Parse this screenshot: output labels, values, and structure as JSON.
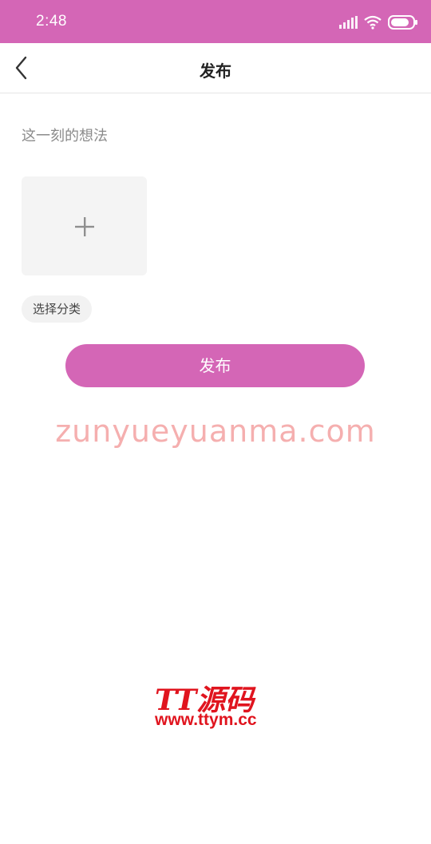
{
  "status_bar": {
    "time": "2:48",
    "icons": [
      "signal-icon",
      "wifi-icon",
      "battery-icon"
    ]
  },
  "nav": {
    "title": "发布",
    "back_icon": "chevron-left-icon"
  },
  "form": {
    "thought_placeholder": "这一刻的想法",
    "thought_value": "",
    "image_picker_icon": "plus-icon",
    "category_label": "选择分类",
    "publish_label": "发布"
  },
  "watermarks": {
    "site": "zunyueyuanma.com",
    "logo_text": "TT源码",
    "logo_url": "www.ttym.cc"
  },
  "colors": {
    "accent": "#d466b6",
    "placeholder": "#8a8a8a",
    "chip_bg": "#f2f2f2",
    "picker_bg": "#f4f4f4",
    "watermark_site": "#f4a7a7",
    "logo_red": "#e0141e"
  }
}
